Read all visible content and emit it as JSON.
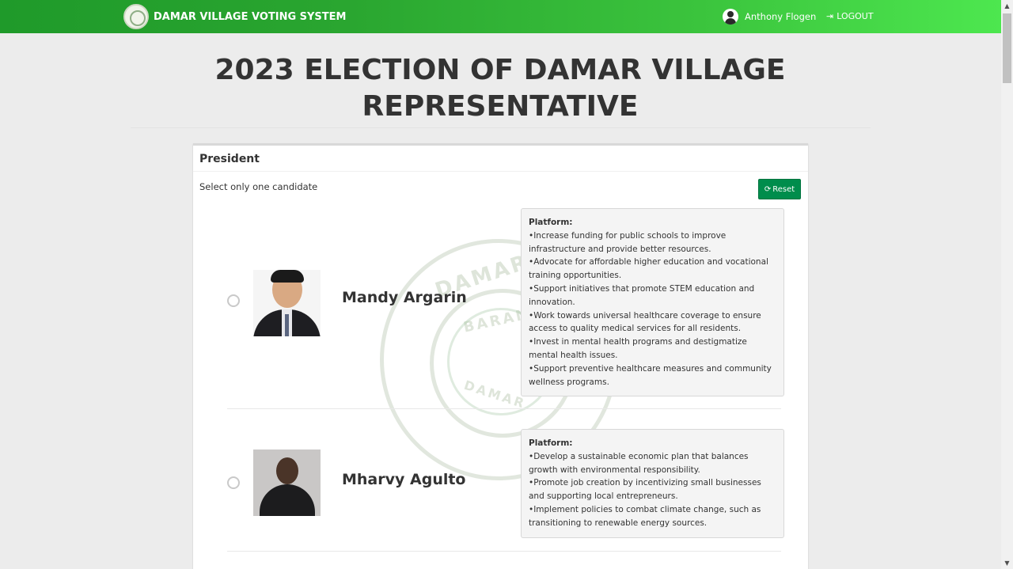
{
  "navbar": {
    "brand": "DAMAR VILLAGE VOTING SYSTEM",
    "user_name": "Anthony Flogen",
    "logout_label": "LOGOUT"
  },
  "page": {
    "title": "2023 ELECTION OF DAMAR VILLAGE REPRESENTATIVE"
  },
  "ballot": {
    "position": "President",
    "instruction": "Select only one candidate",
    "reset_label": "Reset",
    "seal_text": [
      "DAMAR V",
      "BARAN",
      "DAMAR"
    ],
    "candidates": [
      {
        "name": "Mandy Argarin",
        "platform_title": "Platform:",
        "platform": [
          "•Increase funding for public schools to improve infrastructure and provide better resources.",
          "•Advocate for affordable higher education and vocational training opportunities.",
          "•Support initiatives that promote STEM education and innovation.",
          "•Work towards universal healthcare coverage to ensure access to quality medical services for all residents.",
          "•Invest in mental health programs and destigmatize mental health issues.",
          "•Support preventive healthcare measures and community wellness programs."
        ]
      },
      {
        "name": "Mharvy Agulto",
        "platform_title": "Platform:",
        "platform": [
          "•Develop a sustainable economic plan that balances growth with environmental responsibility.",
          "•Promote job creation by incentivizing small businesses and supporting local entrepreneurs.",
          "•Implement policies to combat climate change, such as transitioning to renewable energy sources."
        ]
      }
    ]
  },
  "colors": {
    "nav_start": "#1f9a2a",
    "nav_end": "#4de74f",
    "reset_button": "#008d4c"
  }
}
